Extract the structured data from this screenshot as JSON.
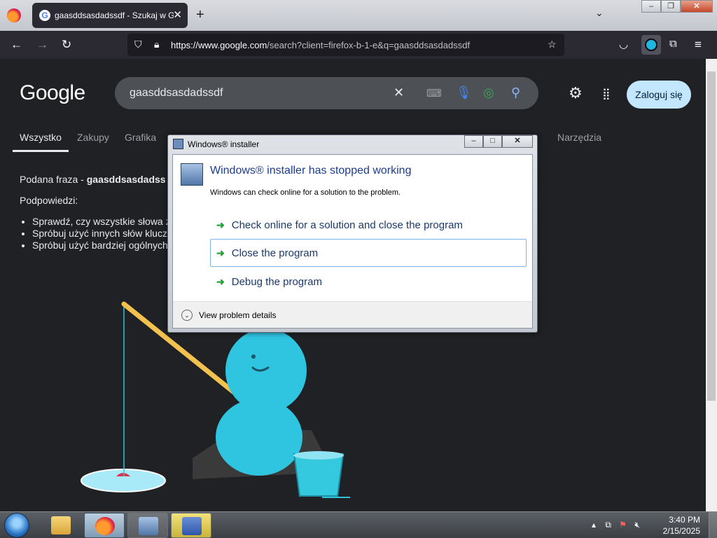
{
  "browser": {
    "tab_title": "gaasddsasdadssdf - Szukaj w G",
    "url_host": "https://www.google.com",
    "url_path": "/search?client=firefox-b-1-e&q=gaasddsasdadssdf",
    "newtab_glyph": "+",
    "tab_close_glyph": "✕"
  },
  "google": {
    "logo": "Google",
    "query": "gaasddsasdadssdf",
    "login_label": "Zaloguj się",
    "tabs": [
      "Wszystko",
      "Zakupy",
      "Grafika",
      "Narzędzia"
    ],
    "no_results_prefix": "Podana fraza - ",
    "no_results_term": "gaasddsasdadss",
    "hints_title": "Podpowiedzi:",
    "hints": [
      "Sprawdź, czy wszystkie słowa z",
      "Spróbuj użyć innych słów klucz",
      "Spróbuj użyć bardziej ogólnych"
    ]
  },
  "dialog": {
    "title": "Windows® installer",
    "heading": "Windows® installer has stopped working",
    "subtext": "Windows can check online for a solution to the problem.",
    "options": [
      "Check online for a solution and close the program",
      "Close the program",
      "Debug the program"
    ],
    "details_label": "View problem details"
  },
  "taskbar": {
    "time": "3:40 PM",
    "date": "2/15/2025"
  },
  "colors": {
    "page_bg": "#202124",
    "firefox_toolbar": "#2b2a33",
    "login_bg": "#c2e7ff",
    "dialog_heading": "#1e3c8c",
    "option_arrow": "#27a13a"
  },
  "icons": [
    "firefox-icon",
    "google-g-icon",
    "back-icon",
    "forward-icon",
    "reload-icon",
    "shield-icon",
    "lock-icon",
    "star-icon",
    "pocket-icon",
    "extension-icon",
    "puzzle-icon",
    "menu-icon",
    "clear-icon",
    "keyboard-icon",
    "mic-icon",
    "lens-icon",
    "search-icon",
    "gear-icon",
    "apps-icon",
    "start-orb-icon",
    "explorer-icon",
    "installer-icon"
  ]
}
